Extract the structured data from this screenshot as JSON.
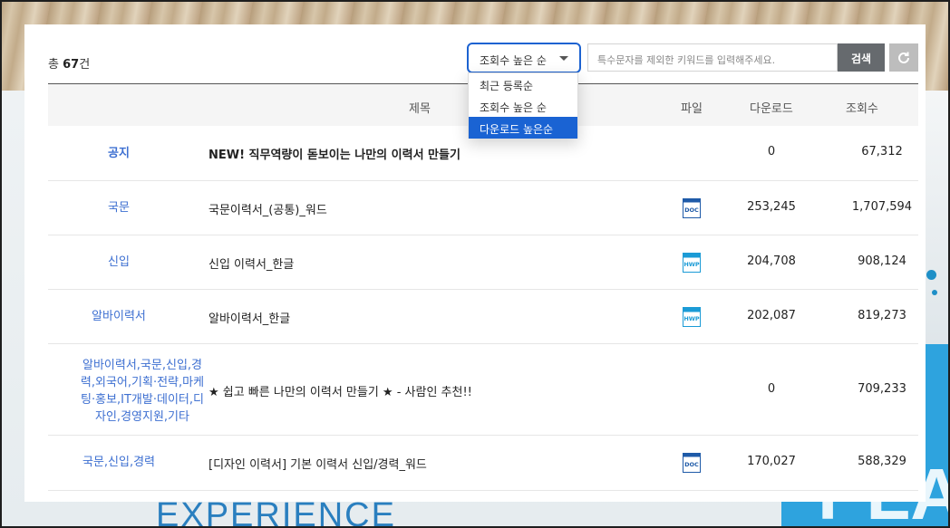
{
  "background": {
    "text_bottom": "EXPERIENCE",
    "text_right": "PLA"
  },
  "summary": {
    "prefix": "총",
    "count": "67",
    "suffix": "건"
  },
  "sort": {
    "selected": "조회수 높은 순",
    "options": [
      "최근 등록순",
      "조회수 높은 순",
      "다운로드 높은순"
    ],
    "highlighted_index": 2
  },
  "search": {
    "placeholder": "특수문자를 제외한 키워드를 입력해주세요.",
    "button_label": "검색"
  },
  "table": {
    "headers": {
      "title": "제목",
      "file": "파일",
      "downloads": "다운로드",
      "views": "조회수"
    },
    "rows": [
      {
        "category": "공지",
        "title": "NEW! 직무역량이 돋보이는 나만의 이력서 만들기",
        "file": "",
        "downloads": "0",
        "views": "67,312"
      },
      {
        "category": "국문",
        "title": "국문이력서_(공통)_워드",
        "file": "doc-icon",
        "downloads": "253,245",
        "views": "1,707,594"
      },
      {
        "category": "신입",
        "title": "신입 이력서_한글",
        "file": "hwp-icon",
        "downloads": "204,708",
        "views": "908,124"
      },
      {
        "category": "알바이력서",
        "title": "알바이력서_한글",
        "file": "hwp-icon",
        "downloads": "202,087",
        "views": "819,273"
      },
      {
        "category": "알바이력서,국문,신입,경력,외국어,기획·전략,마케팅·홍보,IT개발·데이터,디자인,경영지원,기타",
        "title": "★ 쉽고 빠른 나만의 이력서 만들기 ★ - 사람인 추천!!",
        "file": "",
        "downloads": "0",
        "views": "709,233"
      },
      {
        "category": "국문,신입,경력",
        "title": "[디자인 이력서] 기본 이력서 신입/경력_워드",
        "file": "doc-icon",
        "downloads": "170,027",
        "views": "588,329"
      }
    ]
  },
  "colors": {
    "accent_blue": "#1a63d3",
    "category_blue": "#3d6fd1",
    "doc_icon": "#1e5aa8",
    "hwp_icon": "#1b9bd6"
  }
}
